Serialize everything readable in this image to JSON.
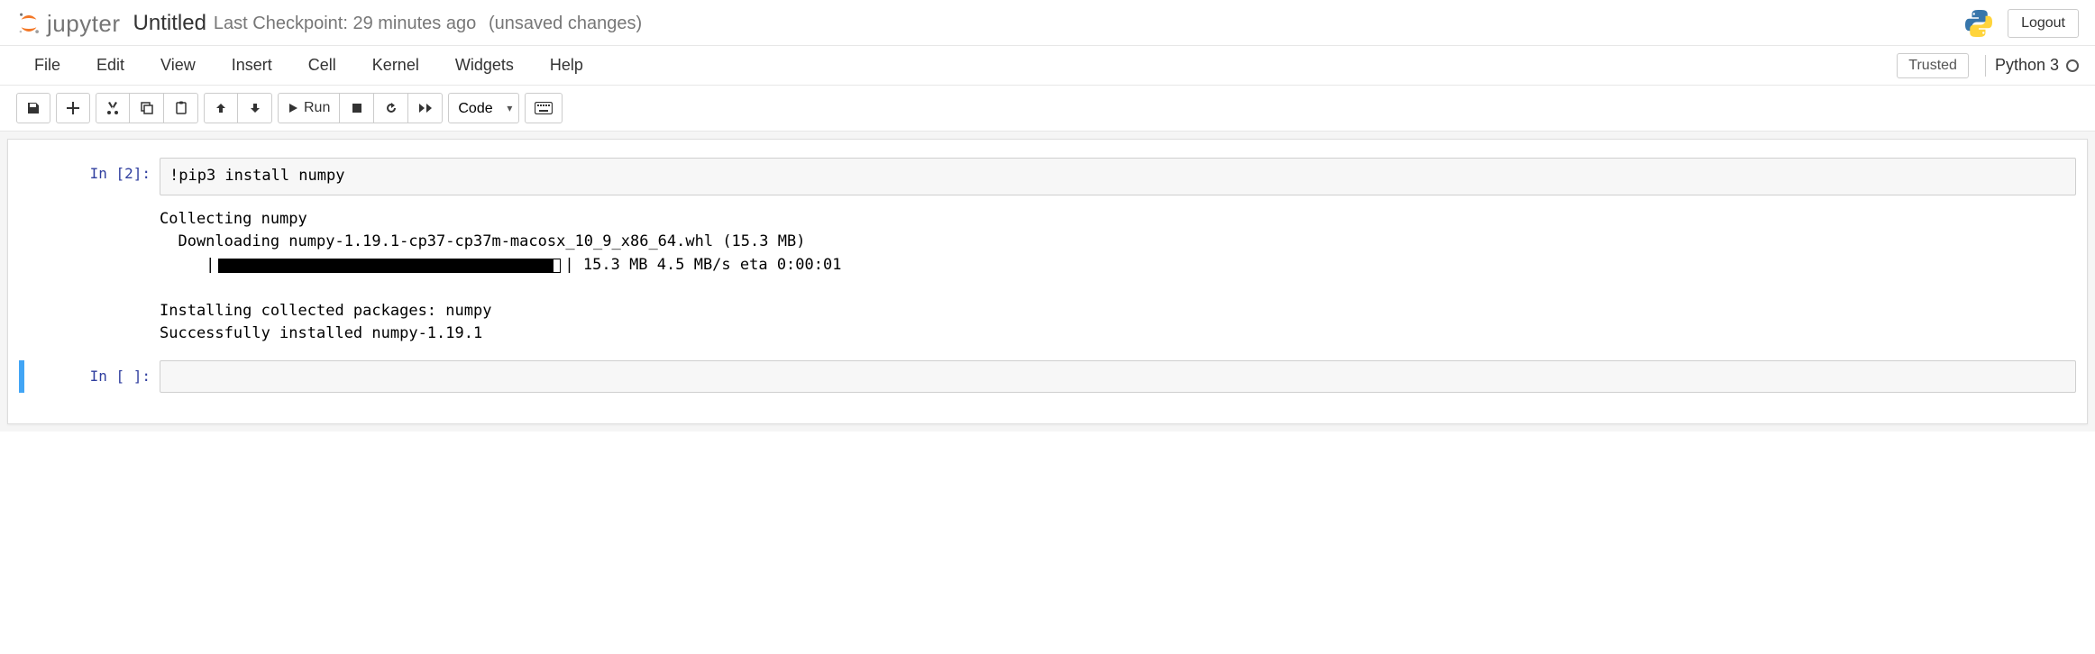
{
  "header": {
    "logo_text": "jupyter",
    "title": "Untitled",
    "checkpoint": "Last Checkpoint: 29 minutes ago",
    "unsaved": "(unsaved changes)",
    "logout": "Logout"
  },
  "menubar": {
    "items": [
      "File",
      "Edit",
      "View",
      "Insert",
      "Cell",
      "Kernel",
      "Widgets",
      "Help"
    ],
    "trusted": "Trusted",
    "kernel_name": "Python 3"
  },
  "toolbar": {
    "run_label": "Run",
    "cell_type": "Code"
  },
  "cells": [
    {
      "prompt": "In [2]:",
      "code": "!pip3 install numpy",
      "output": {
        "line1": "Collecting numpy",
        "line2": "  Downloading numpy-1.19.1-cp37-cp37m-macosx_10_9_x86_64.whl (15.3 MB)",
        "progress_left": "     |",
        "progress_right": "| 15.3 MB 4.5 MB/s eta 0:00:01",
        "line4": "Installing collected packages: numpy",
        "line5": "Successfully installed numpy-1.19.1"
      }
    },
    {
      "prompt": "In [ ]:",
      "code": ""
    }
  ]
}
